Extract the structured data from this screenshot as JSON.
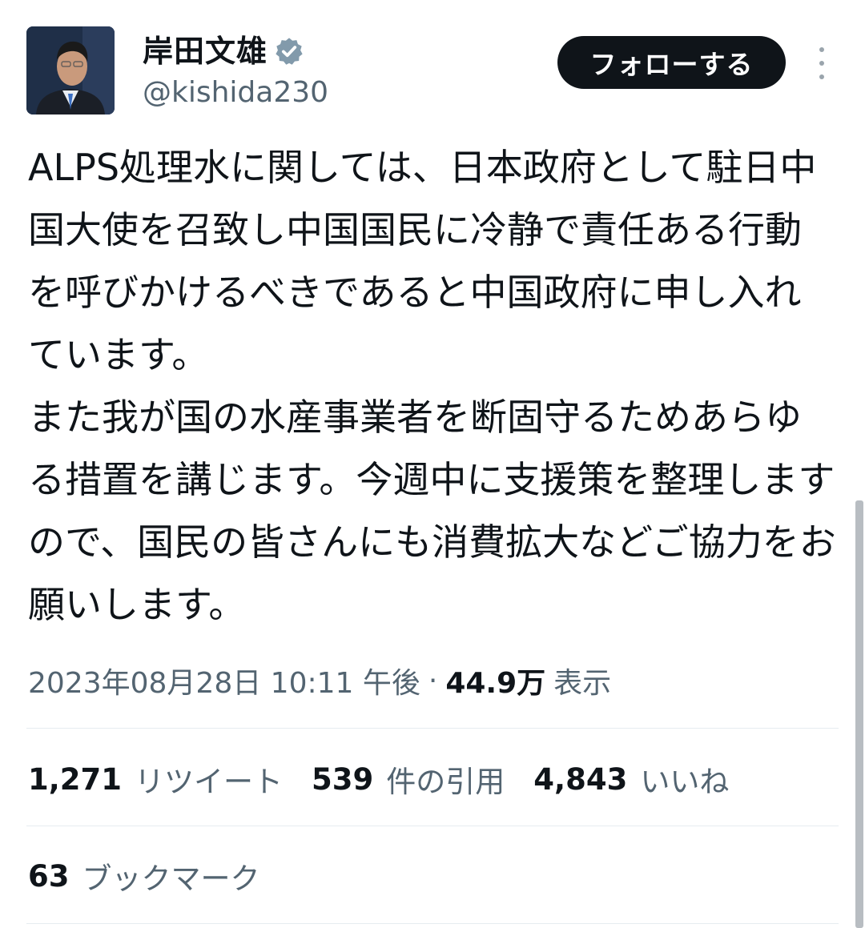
{
  "author": {
    "display_name": "岸田文雄",
    "handle": "@kishida230",
    "verified_icon": "verified-badge-icon",
    "verified_color": "#829aab"
  },
  "actions": {
    "follow_label": "フォローする",
    "more_icon": "more-vertical-icon"
  },
  "tweet": {
    "text": "ALPS処理水に関しては、日本政府として駐日中国大使を召致し中国国民に冷静で責任ある行動を呼びかけるべきであると中国政府に申し入れています。\nまた我が国の水産事業者を断固守るためあらゆる措置を講じます。今週中に支援策を整理しますので、国民の皆さんにも消費拡大などご協力をお願いします。"
  },
  "meta": {
    "timestamp": "2023年08月28日 10:11 午後",
    "separator": "·",
    "views_count": "44.9万",
    "views_label": "表示"
  },
  "stats": {
    "retweets_count": "1,271",
    "retweets_label": "リツイート",
    "quotes_count": "539",
    "quotes_label": "件の引用",
    "likes_count": "4,843",
    "likes_label": "いいね",
    "bookmarks_count": "63",
    "bookmarks_label": "ブックマーク"
  },
  "colors": {
    "text_primary": "#0f1419",
    "text_secondary": "#536471",
    "button_bg": "#0f1419",
    "divider": "#e6ecf0"
  }
}
